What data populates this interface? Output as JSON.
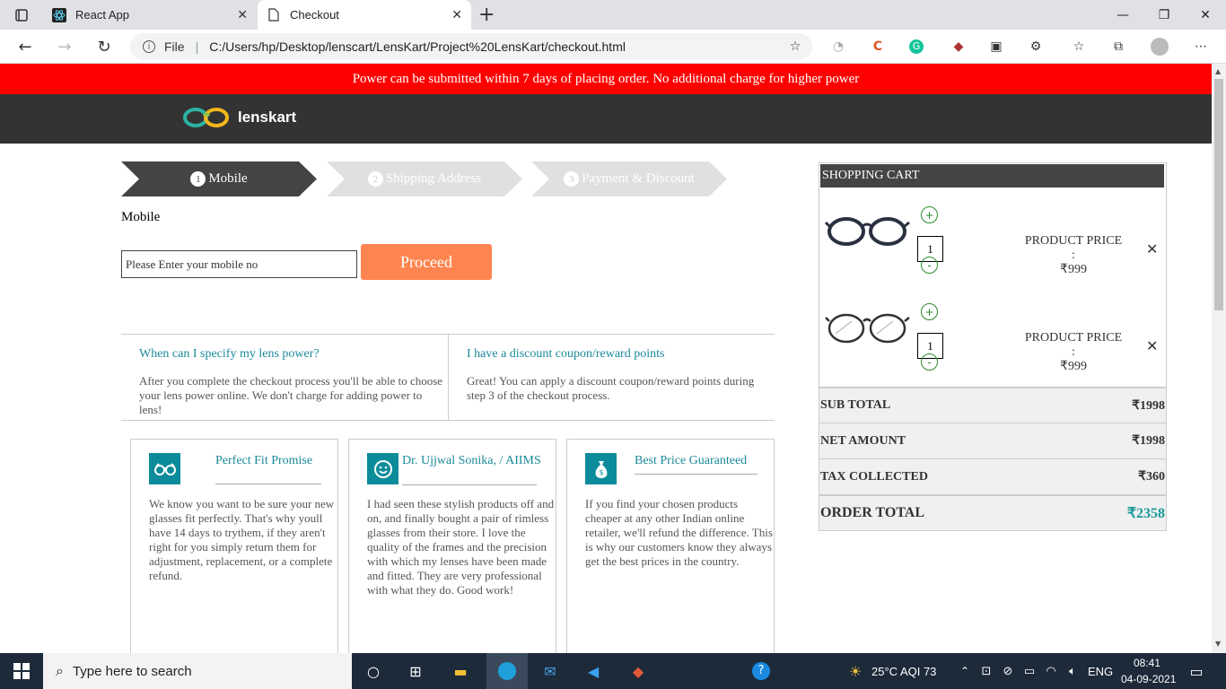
{
  "browser": {
    "tabs": [
      {
        "title": "React App",
        "active": false
      },
      {
        "title": "Checkout",
        "active": true
      }
    ],
    "url_label": "File",
    "url": "C:/Users/hp/Desktop/lenscart/LensKart/Project%20LensKart/checkout.html"
  },
  "promo_banner": "Power can be submitted within 7 days of placing order. No additional charge for higher power",
  "logo_text": "lenskart",
  "steps": [
    {
      "num": "1",
      "label": "Mobile",
      "state": "active"
    },
    {
      "num": "2",
      "label": "Shipping Address",
      "state": "inactive"
    },
    {
      "num": "3",
      "label": "Payment & Discount",
      "state": "inactive"
    }
  ],
  "mobile_form": {
    "label": "Mobile",
    "placeholder": "Please Enter your mobile no",
    "proceed_label": "Proceed"
  },
  "faq": [
    {
      "q": "When can I specify my lens power?",
      "a": "After you complete the checkout process you'll be able to choose your lens power online. We don't charge for adding power to lens!"
    },
    {
      "q": "I have a discount coupon/reward points",
      "a": "Great! You can apply a discount coupon/reward points during step 3 of the checkout process."
    }
  ],
  "cards": [
    {
      "title": "Perfect Fit Promise",
      "icon": "glasses-icon",
      "body": "We know you want to be sure your new glasses fit perfectly. That's why youll have 14 days to trythem, if they aren't right for you simply return them for adjustment, replacement, or a complete refund."
    },
    {
      "title": "Dr. Ujjwal Sonika, / AIIMS",
      "icon": "smiley-icon",
      "body": "I had seen these stylish products off and on, and finally bought a pair of rimless glasses from their store. I love the quality of the frames and the precision with which my lenses have been made and fitted. They are very professional with what they do. Good work!"
    },
    {
      "title": "Best Price Guaranteed",
      "icon": "money-bag-icon",
      "body": "If you find your chosen products cheaper at any other Indian online retailer, we'll refund the difference. This is why our customers know they always get the best prices in the country."
    }
  ],
  "cart": {
    "title": "SHOPPING CART",
    "items": [
      {
        "qty": "1",
        "price_label": "PRODUCT PRICE :",
        "price": "₹999",
        "plus": "+",
        "minus": "-"
      },
      {
        "qty": "1",
        "price_label": "PRODUCT PRICE :",
        "price": "₹999",
        "plus": "+",
        "minus": "-"
      }
    ],
    "summary": [
      {
        "label": "SUB TOTAL",
        "value": "₹1998"
      },
      {
        "label": "NET AMOUNT",
        "value": "₹1998"
      },
      {
        "label": "TAX COLLECTED",
        "value": "₹360"
      }
    ],
    "total": {
      "label": "ORDER TOTAL",
      "value": "₹2358"
    }
  },
  "taskbar": {
    "search_placeholder": "Type here to search",
    "weather": "25°C  AQI 73",
    "lang": "ENG",
    "time": "08:41",
    "date": "04-09-2021"
  },
  "colors": {
    "promo": "#ff0000",
    "header": "#333333",
    "accent_teal": "#1a8a9a",
    "proceed": "#ff8550"
  }
}
